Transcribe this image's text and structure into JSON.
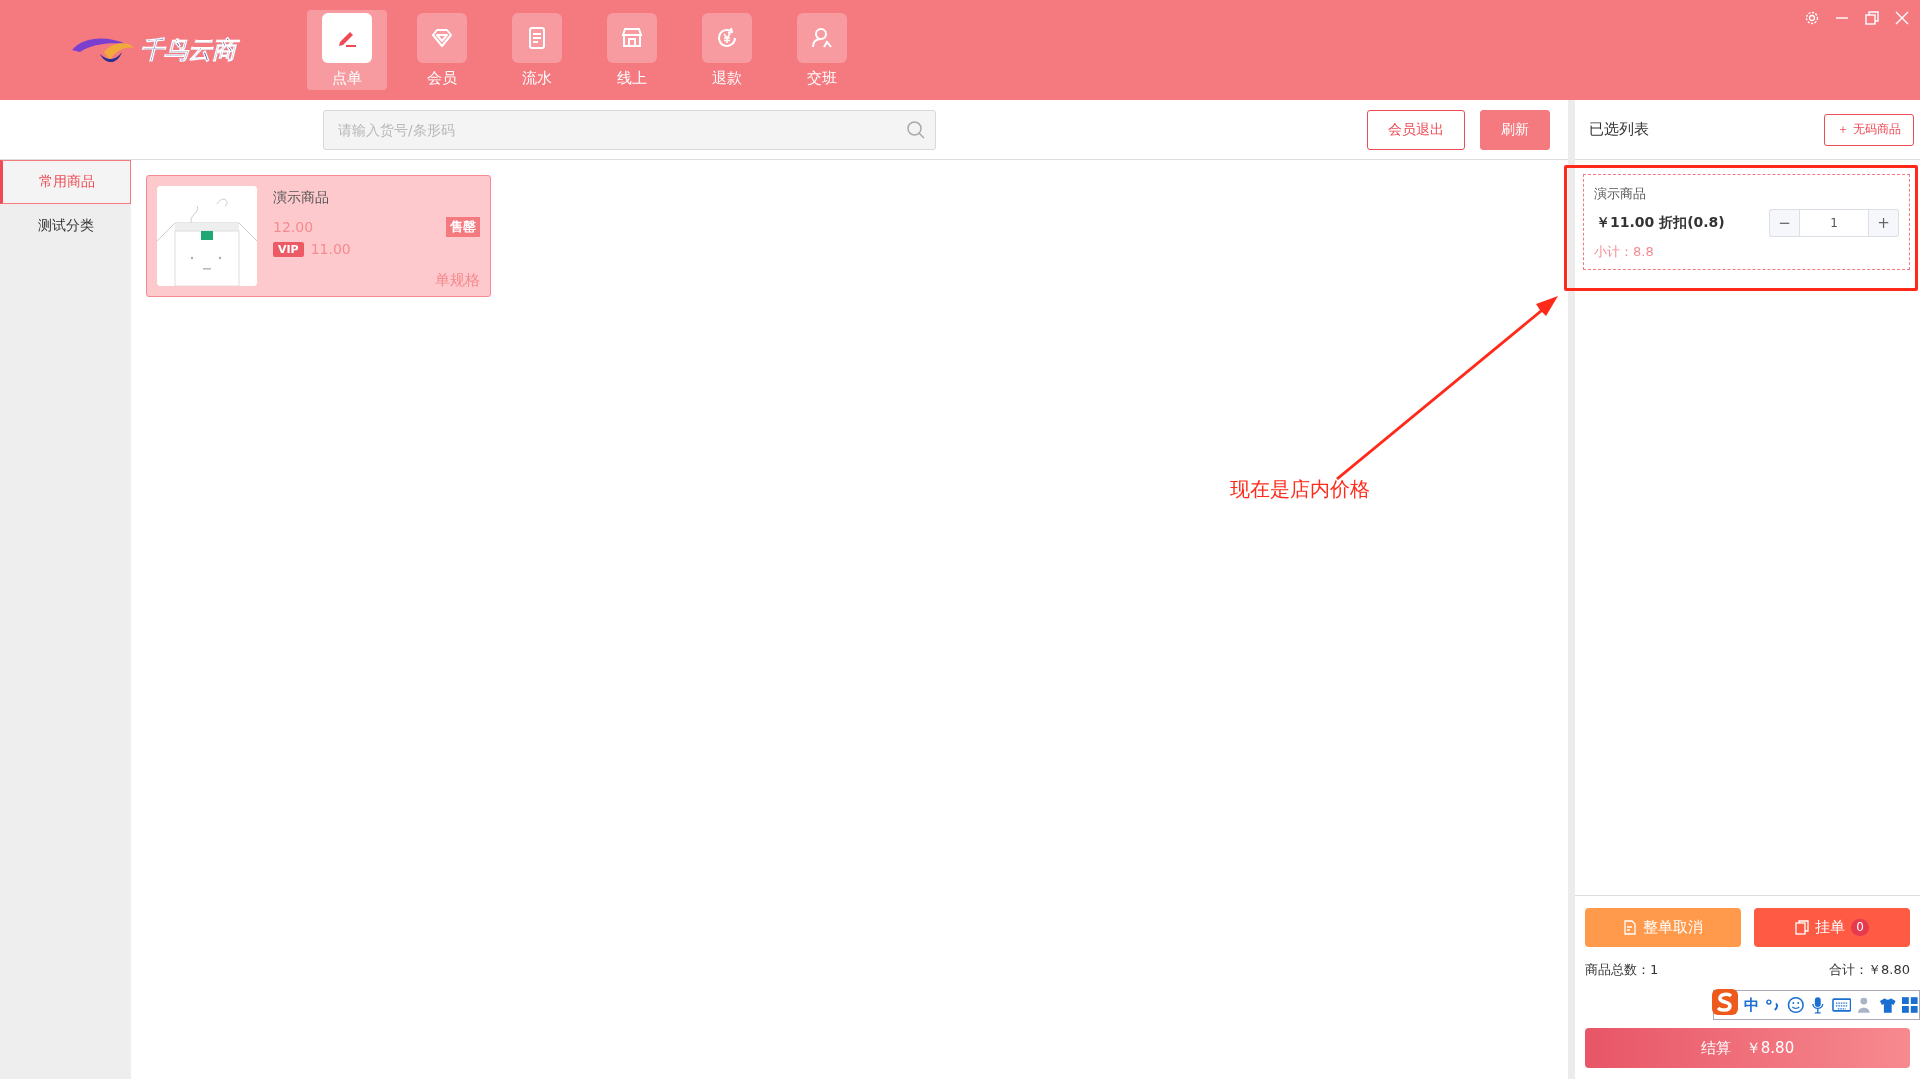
{
  "app": {
    "logo_text": "千鸟云商"
  },
  "nav_tabs": [
    {
      "label": "点单",
      "selected": true
    },
    {
      "label": "会员",
      "selected": false
    },
    {
      "label": "流水",
      "selected": false
    },
    {
      "label": "线上",
      "selected": false
    },
    {
      "label": "退款",
      "selected": false
    },
    {
      "label": "交班",
      "selected": false
    }
  ],
  "search": {
    "placeholder": "请输入货号/条形码"
  },
  "toolbar_buttons": [
    {
      "label": "会员退出",
      "kind": "outline"
    },
    {
      "label": "刷新",
      "kind": "filled"
    }
  ],
  "categories": [
    {
      "label": "常用商品",
      "selected": true
    },
    {
      "label": "测试分类",
      "selected": false
    }
  ],
  "products": [
    {
      "name": "演示商品",
      "price": "12.00",
      "badge": "售罄",
      "vip_tag": "VIP",
      "vip_price": "11.00",
      "spec": "单规格"
    }
  ],
  "cart": {
    "title": "已选列表",
    "add_button": "＋ 无码商品",
    "items": [
      {
        "name": "演示商品",
        "price_line": "￥11.00 折扣(0.8)",
        "subtotal": "小计：8.8",
        "quantity": "1",
        "decrement": "−",
        "increment": "+"
      }
    ],
    "cancel_button": "整单取消",
    "hold_button": "挂单",
    "hold_count": "0",
    "total_count": "商品总数：1",
    "total": "合计：￥8.80",
    "checkout_label": "结算",
    "checkout_amount": "￥8.80"
  },
  "annotation": {
    "text": "现在是店内价格"
  },
  "ime_bar": {
    "mode": "中"
  }
}
